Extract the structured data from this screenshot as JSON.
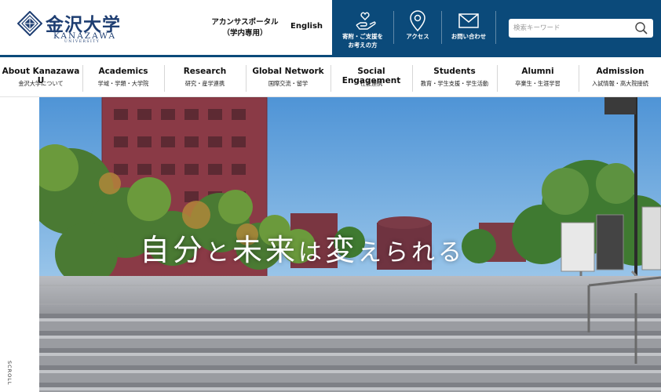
{
  "header": {
    "logo": {
      "ja": "金沢大学",
      "en": "KANAZAWA",
      "en_sub": "UNIVERSITY"
    },
    "portal": {
      "line1": "アカンサスポータル",
      "line2": "（学内専用）"
    },
    "english_link": "English",
    "utility": [
      {
        "icon": "donation-hand-icon",
        "line1": "寄附・ご支援を",
        "line2": "お考えの方"
      },
      {
        "icon": "map-pin-icon",
        "line1": "アクセス",
        "line2": ""
      },
      {
        "icon": "mail-envelope-icon",
        "line1": "お問い合わせ",
        "line2": ""
      }
    ],
    "search": {
      "placeholder": "検索キーワード",
      "value": ""
    }
  },
  "nav": [
    {
      "en": "About Kanazawa U",
      "ja": "金沢大学について"
    },
    {
      "en": "Academics",
      "ja": "学域・学類・大学院"
    },
    {
      "en": "Research",
      "ja": "研究・産学連携"
    },
    {
      "en": "Global Network",
      "ja": "国際交流・留学"
    },
    {
      "en": "Social Engagement",
      "ja": "社会連携"
    },
    {
      "en": "Students",
      "ja": "教育・学生支援・学生活動"
    },
    {
      "en": "Alumni",
      "ja": "卒業生・生涯学習"
    },
    {
      "en": "Admission",
      "ja": "入試情報・高大院接続"
    }
  ],
  "hero": {
    "tagline_parts": [
      "自分",
      "と",
      "未来",
      "は",
      "変",
      "え",
      "ら",
      "れ",
      "る"
    ],
    "scroll_label": "SCROLL"
  },
  "colors": {
    "brand_navy": "#0b4a7a",
    "logo_navy": "#1e3e72"
  }
}
